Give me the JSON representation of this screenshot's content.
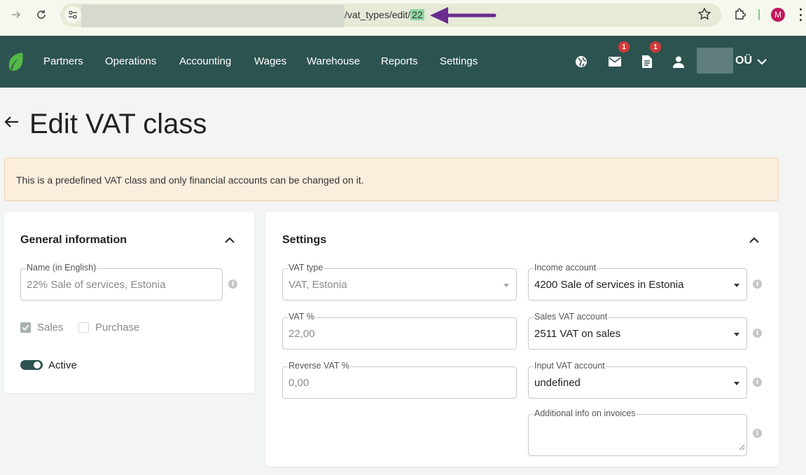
{
  "browser": {
    "url_path": "/vat_types/edit/",
    "url_id": "22",
    "profile_initial": "M"
  },
  "nav": {
    "items": [
      "Partners",
      "Operations",
      "Accounting",
      "Wages",
      "Warehouse",
      "Reports",
      "Settings"
    ],
    "mail_badge": "1",
    "docs_badge": "1",
    "company_suffix": "OÜ"
  },
  "page": {
    "title": "Edit VAT class",
    "notice": "This is a predefined VAT class and only financial accounts can be changed on it."
  },
  "general": {
    "title": "General information",
    "name_label": "Name (in English)",
    "name_value": "22% Sale of services, Estonia",
    "sales_label": "Sales",
    "sales_checked": true,
    "purchase_label": "Purchase",
    "purchase_checked": false,
    "active_label": "Active",
    "active_on": true
  },
  "settings": {
    "title": "Settings",
    "vat_type_label": "VAT type",
    "vat_type_value": "VAT, Estonia",
    "vat_pct_label": "VAT %",
    "vat_pct_value": "22,00",
    "reverse_vat_label": "Reverse VAT %",
    "reverse_vat_value": "0,00",
    "income_account_label": "Income account",
    "income_account_value": "4200 Sale of services in Estonia",
    "sales_vat_label": "Sales VAT account",
    "sales_vat_value": "2511 VAT on sales",
    "input_vat_label": "Input VAT account",
    "input_vat_value": "undefined",
    "additional_info_label": "Additional info on invoices",
    "additional_info_value": ""
  },
  "colors": {
    "nav_bg": "#2d5350",
    "alert_bg": "#fbeedd",
    "annotation_arrow": "#6a2c91",
    "url_highlight": "#8fd6a3",
    "badge": "#d33a3a"
  }
}
